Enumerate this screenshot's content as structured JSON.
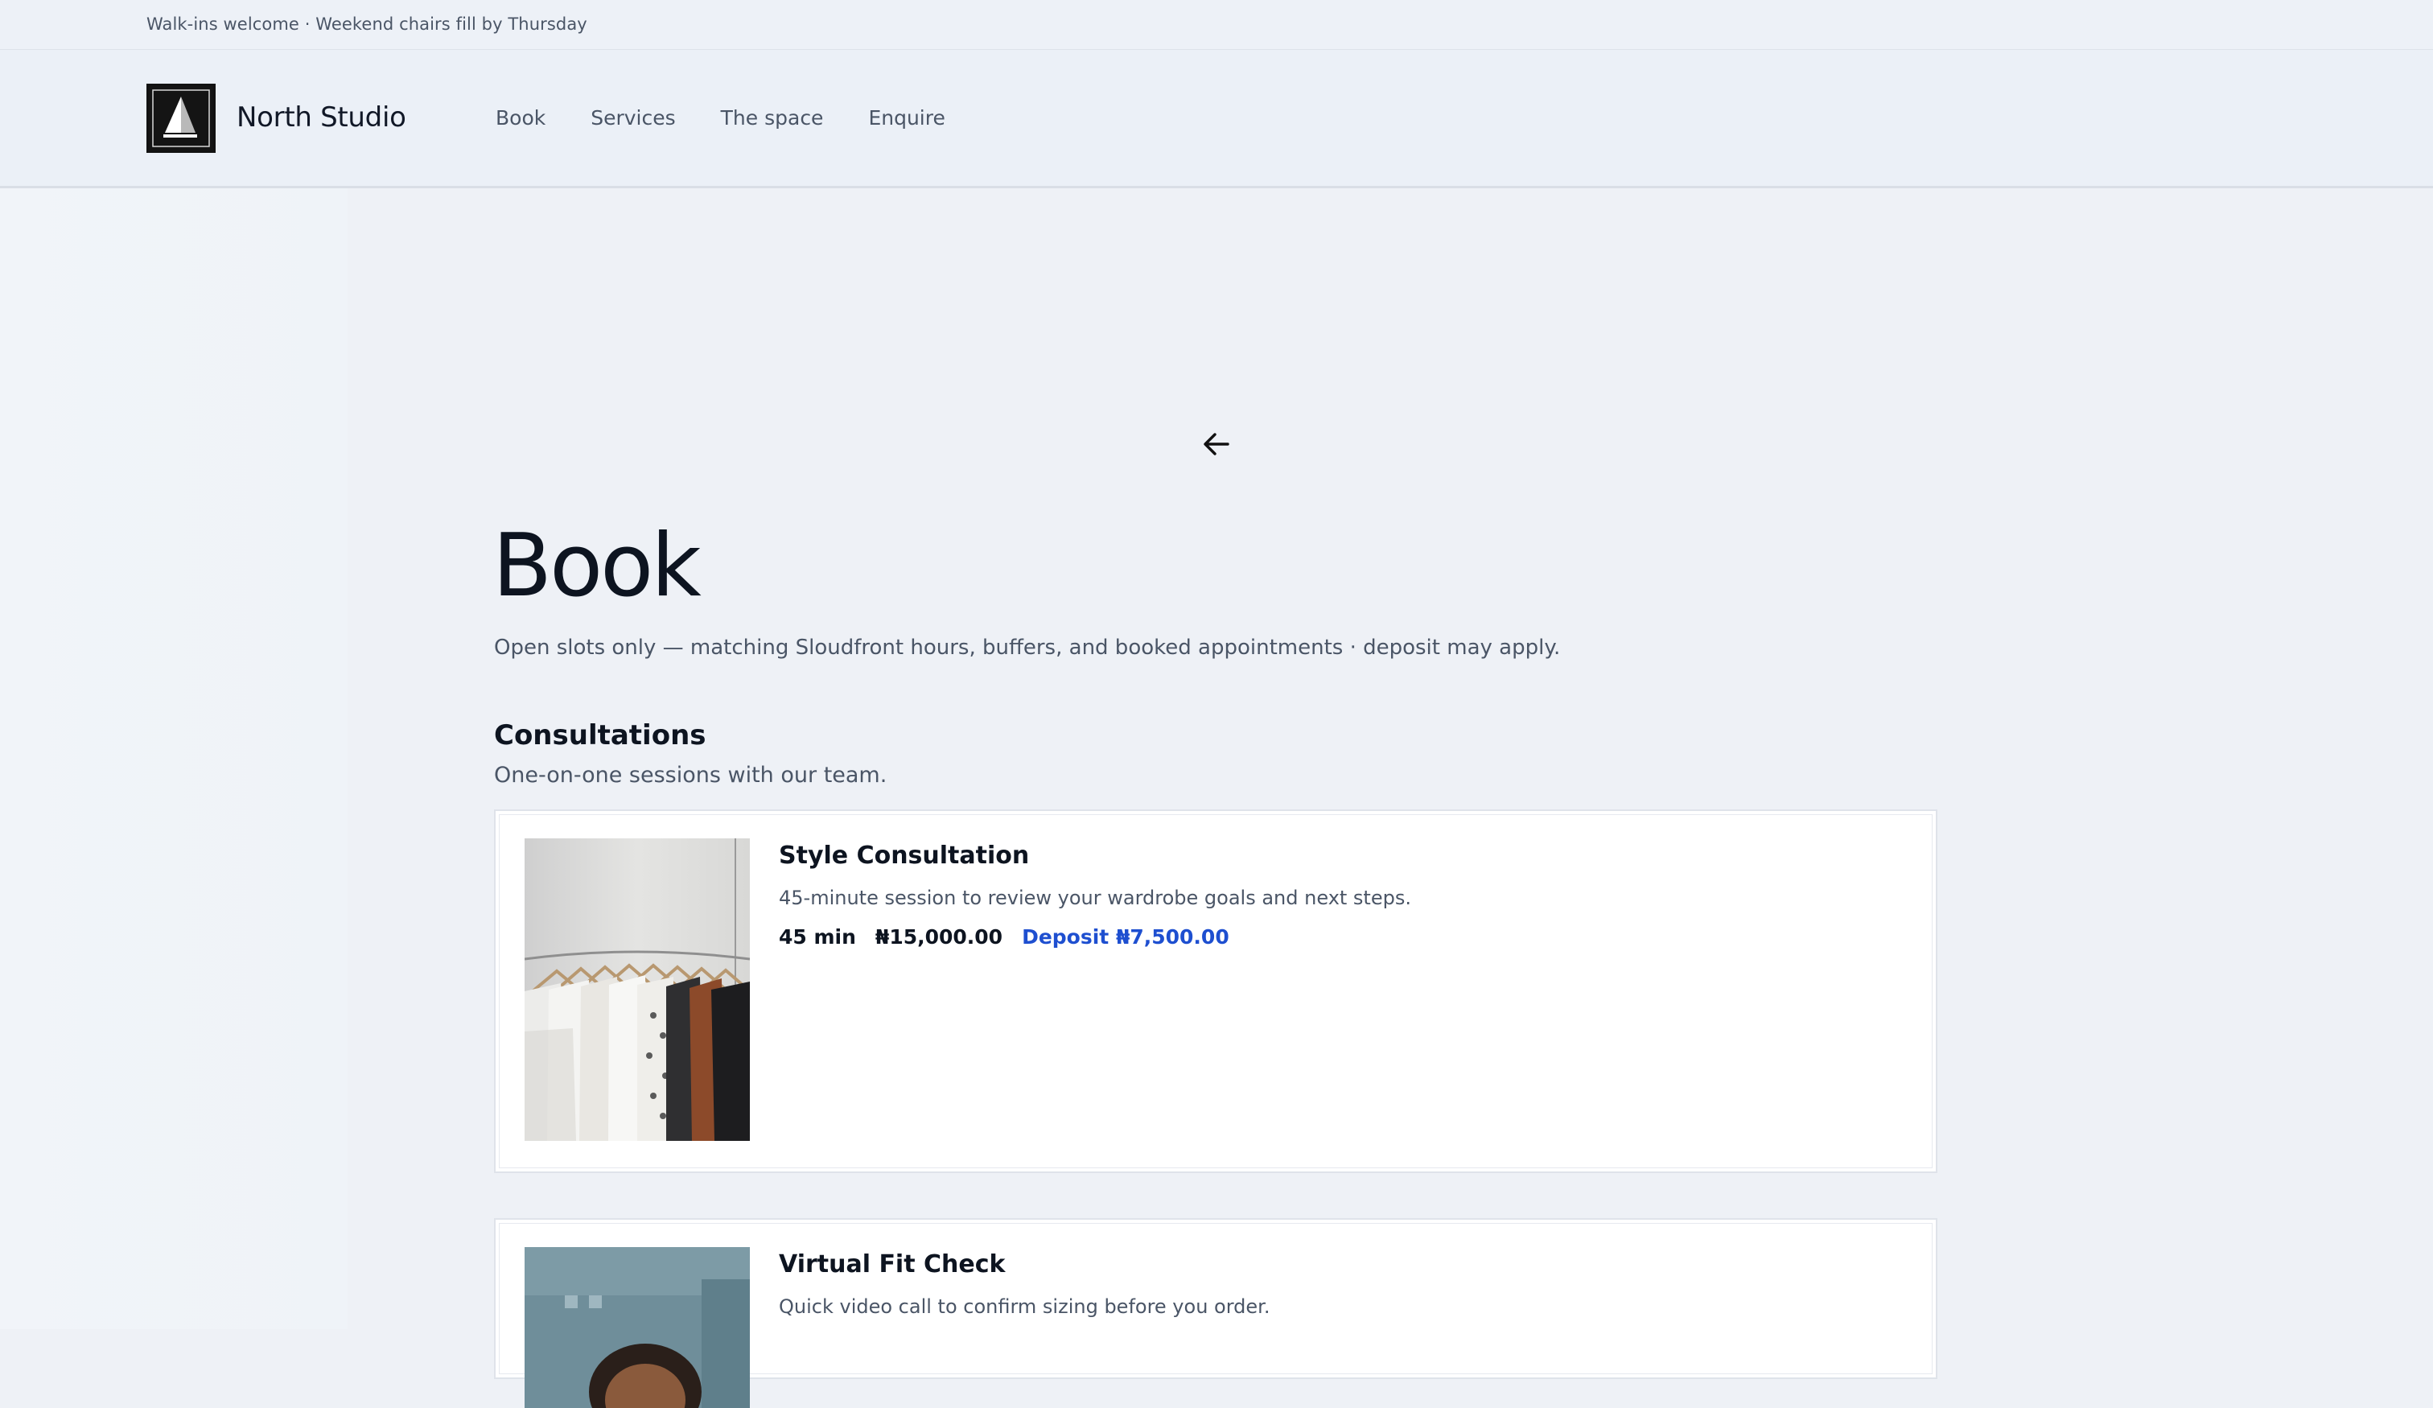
{
  "announcement": {
    "text": "Walk-ins welcome · Weekend chairs fill by Thursday"
  },
  "header": {
    "brand": "North Studio",
    "logo_icon": "sailboat-logo",
    "nav": [
      {
        "label": "Book"
      },
      {
        "label": "Services"
      },
      {
        "label": "The space"
      },
      {
        "label": "Enquire"
      }
    ]
  },
  "page": {
    "back_icon": "arrow-left-icon",
    "title": "Book",
    "subtitle": "Open slots only — matching Sloudfront hours, buffers, and booked appointments · deposit may apply."
  },
  "section": {
    "title": "Consultations",
    "subtitle": "One-on-one sessions with our team."
  },
  "services": [
    {
      "title": "Style Consultation",
      "description": "45-minute session to review your wardrobe goals and next steps.",
      "duration": "45 min",
      "price": "₦15,000.00",
      "deposit": "Deposit ₦7,500.00",
      "image": "clothing-rack-photo"
    },
    {
      "title": "Virtual Fit Check",
      "description": "Quick video call to confirm sizing before you order.",
      "image": "person-photo"
    }
  ],
  "colors": {
    "accent": "#1e4fd0",
    "text": "#0d1420",
    "muted": "#4a5566",
    "background": "#eef1f6"
  }
}
